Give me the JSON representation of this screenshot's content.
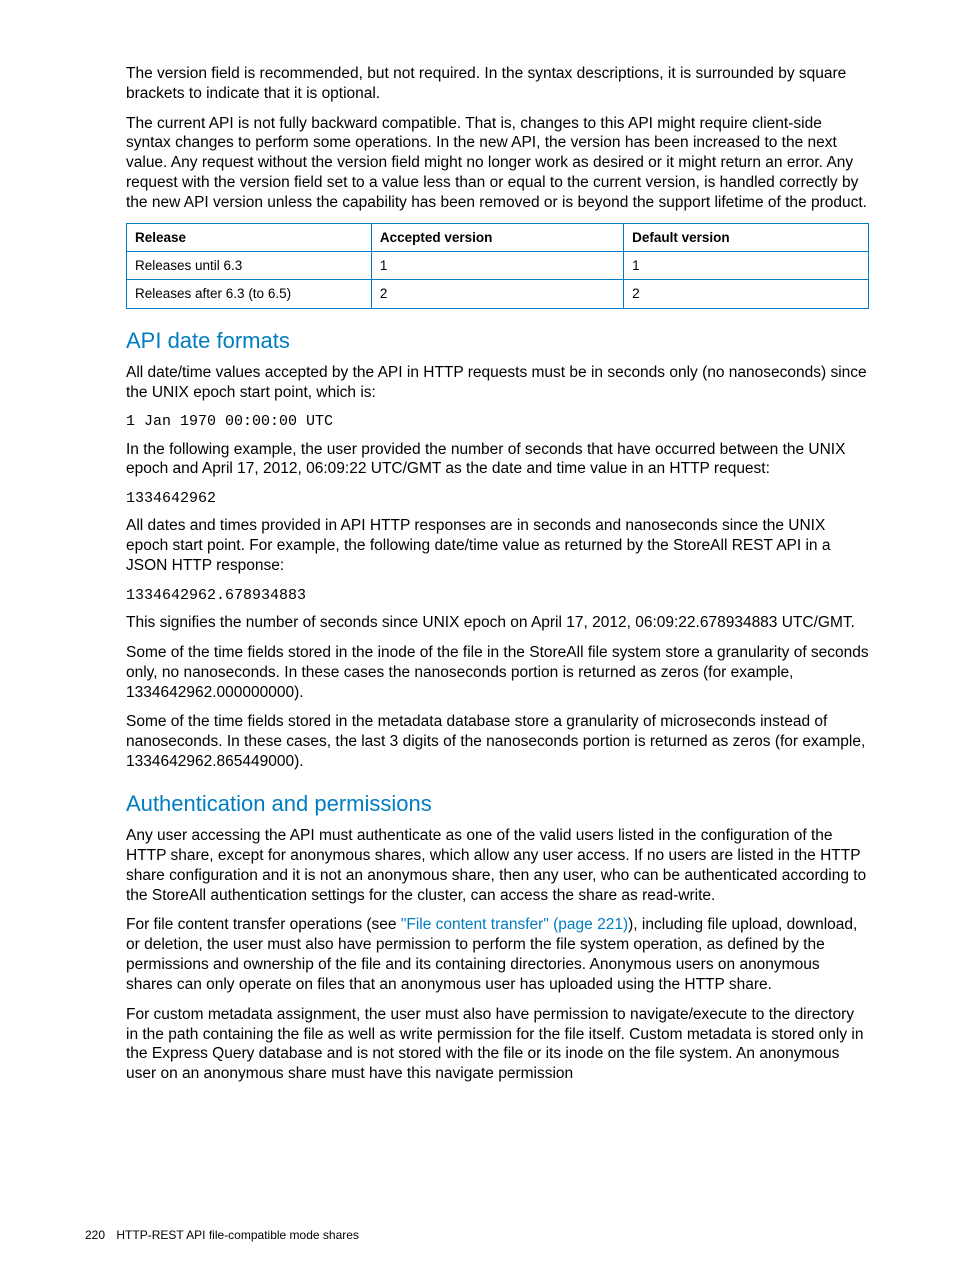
{
  "p1": "The version field is recommended, but not required. In the syntax descriptions, it is surrounded by square brackets to indicate that it is optional.",
  "p2": "The current API is not fully backward compatible. That is, changes to this API might require client-side syntax changes to perform some operations. In the new API, the version has been increased to the next value. Any request without the version field might no longer work as desired or it might return an error. Any request with the version field set to a value less than or equal to the current version, is handled correctly by the new API version unless the capability has been removed or is beyond the support lifetime of the product.",
  "table": {
    "headers": {
      "release": "Release",
      "accepted": "Accepted version",
      "default": "Default version"
    },
    "rows": [
      {
        "release": "Releases until 6.3",
        "accepted": "1",
        "default": "1"
      },
      {
        "release": "Releases after 6.3 (to 6.5)",
        "accepted": "2",
        "default": "2"
      }
    ]
  },
  "h_api": "API date formats",
  "p3": "All date/time values accepted by the API in HTTP requests must be in seconds only (no nanoseconds) since the UNIX epoch start point, which is:",
  "code1": "1 Jan 1970 00:00:00 UTC",
  "p4": "In the following example, the user provided the number of seconds that have occurred between the UNIX epoch and April 17, 2012, 06:09:22 UTC/GMT as the date and time value in an HTTP request:",
  "code2": "1334642962",
  "p5": "All dates and times provided in API HTTP responses are in seconds and nanoseconds since the UNIX epoch start point. For example, the following date/time value as returned by the StoreAll REST API in a JSON HTTP response:",
  "code3": "1334642962.678934883",
  "p6": "This signifies the number of seconds since UNIX epoch on April 17, 2012, 06:09:22.678934883 UTC/GMT.",
  "p7": "Some of the time fields stored in the inode of the file in the StoreAll file system store a granularity of seconds only, no nanoseconds. In these cases the nanoseconds portion is returned as zeros (for example, 1334642962.000000000).",
  "p8": "Some of the time fields stored in the metadata database store a granularity of microseconds instead of nanoseconds. In these cases, the last 3 digits of the nanoseconds portion is returned as zeros (for example, 1334642962.865449000).",
  "h_auth": "Authentication and permissions",
  "p9": "Any user accessing the API must authenticate as one of the valid users listed in the configuration of the HTTP share, except for anonymous shares, which allow any user access. If no users are listed in the HTTP share configuration and it is not an anonymous share, then any user, who can be authenticated according to the StoreAll authentication settings for the cluster, can access the share as read-write.",
  "p10a": "For file content transfer operations (see ",
  "link1": "\"File content transfer\" (page 221)",
  "p10b": "), including file upload, download, or deletion, the user must also have permission to perform the file system operation, as defined by the permissions and ownership of the file and its containing directories. Anonymous users on anonymous shares can only operate on files that an anonymous user has uploaded using the HTTP share.",
  "p11": "For custom metadata assignment, the user must also have permission to navigate/execute to the directory in the path containing the file as well as write permission for the file itself.  Custom metadata is stored only in the Express Query database and is not stored with the file or its inode on the file system. An anonymous user on an anonymous share must have this navigate permission",
  "footer": {
    "page": "220",
    "title": "HTTP-REST API file-compatible mode shares"
  }
}
